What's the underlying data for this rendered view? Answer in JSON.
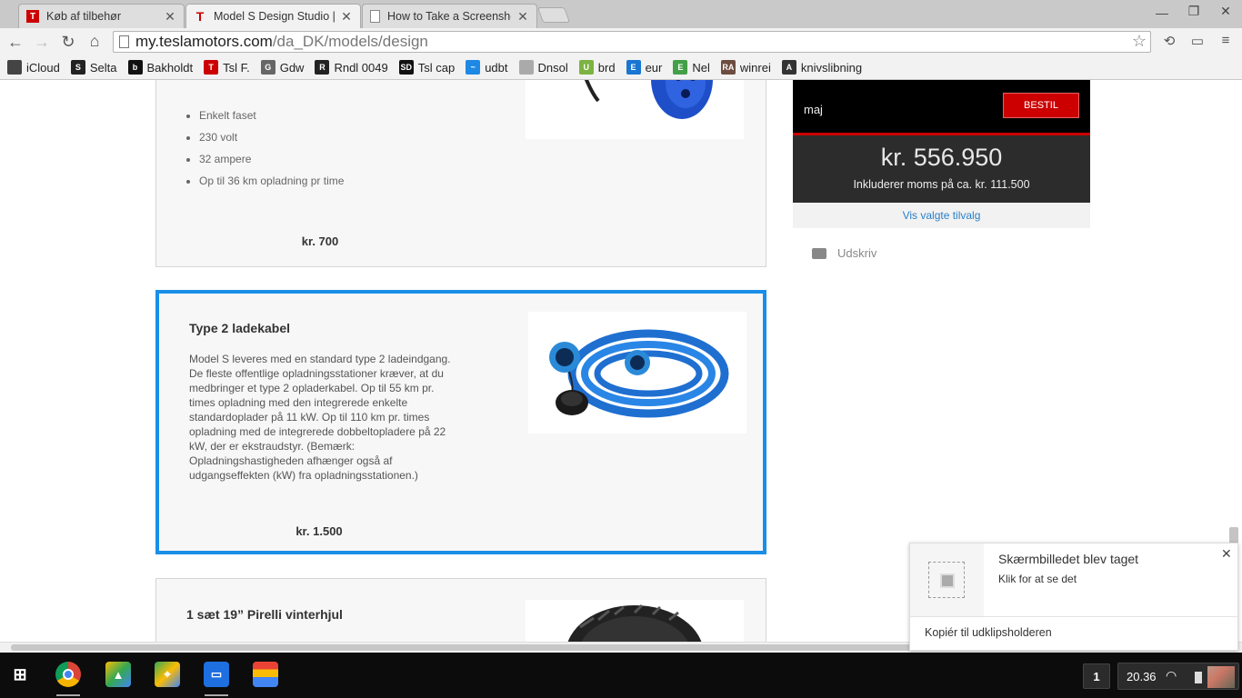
{
  "tabs": [
    {
      "title": "Køb af tilbehør",
      "favicon": "T",
      "active": false
    },
    {
      "title": "Model S Design Studio |",
      "favicon": "T",
      "active": true
    },
    {
      "title": "How to Take a Screenshc",
      "favicon": "page",
      "active": false
    }
  ],
  "address": {
    "host": "my.teslamotors.com",
    "path": "/da_DK/models/design"
  },
  "bookmarks": [
    {
      "label": "iCloud",
      "color": "#444",
      "glyph": ""
    },
    {
      "label": "Selta",
      "color": "#222",
      "glyph": "S"
    },
    {
      "label": "Bakholdt",
      "color": "#111",
      "glyph": "b"
    },
    {
      "label": "Tsl F.",
      "color": "#cc0000",
      "glyph": "T"
    },
    {
      "label": "Gdw",
      "color": "#666",
      "glyph": "G"
    },
    {
      "label": "Rndl 0049",
      "color": "#222",
      "glyph": "R"
    },
    {
      "label": "Tsl cap",
      "color": "#111",
      "glyph": "SD"
    },
    {
      "label": "udbt",
      "color": "#1e88e5",
      "glyph": "~"
    },
    {
      "label": "Dnsol",
      "color": "#aaa",
      "glyph": ""
    },
    {
      "label": "brd",
      "color": "#7cb342",
      "glyph": "U"
    },
    {
      "label": "eur",
      "color": "#1976d2",
      "glyph": "E"
    },
    {
      "label": "Nel",
      "color": "#43a047",
      "glyph": "E"
    },
    {
      "label": "winrei",
      "color": "#6d4c41",
      "glyph": "RA"
    },
    {
      "label": "knivslibning",
      "color": "#333",
      "glyph": "A"
    }
  ],
  "cards": [
    {
      "bullets": [
        "Enkelt faset",
        "230 volt",
        "32 ampere",
        "Op til 36 km opladning pr time"
      ],
      "price": "kr. 700"
    },
    {
      "title": "Type 2 ladekabel",
      "description": "Model S leveres med en standard type 2 ladeindgang. De fleste offentlige opladningsstationer kræver, at du medbringer et type 2 opladerkabel. Op til 55 km pr. times opladning med den integrerede enkelte standardoplader på 11 kW. Op til 110 km pr. times opladning med de integrerede dobbeltopladere på 22 kW, der er ekstraudstyr. (Bemærk: Opladningshastigheden afhænger også af udgangseffekten (kW) fra opladningsstationen.)",
      "price": "kr. 1.500"
    },
    {
      "title": "1 sæt 19” Pirelli vinterhjul"
    }
  ],
  "sidebar": {
    "month": "maj",
    "order_button": "BESTIL",
    "total": "kr. 556.950",
    "vat_note": "Inkluderer moms på ca. kr. 111.500",
    "show_options_link": "Vis valgte tilvalg",
    "print_label": "Udskriv"
  },
  "notification": {
    "title": "Skærmbilledet blev taget",
    "subtitle": "Klik for at se det",
    "action": "Kopiér til udklipsholderen"
  },
  "tray": {
    "notification_count": "1",
    "time": "20.36"
  },
  "colors": {
    "tesla_red": "#cc0000",
    "selection_blue": "#1a8fe8",
    "link_blue": "#2a7fc8"
  }
}
